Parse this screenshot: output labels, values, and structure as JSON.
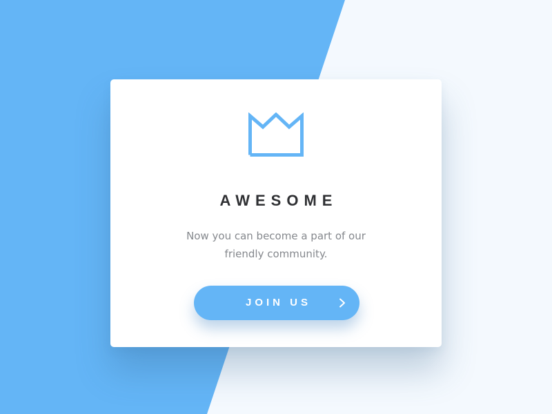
{
  "colors": {
    "page_background": "#f4f9fe",
    "accent_blue": "#64b5f6",
    "card_background": "#ffffff",
    "title_text": "#2f3033",
    "body_text": "#85888d"
  },
  "card": {
    "icon": "crown-icon",
    "title": "AWESOME",
    "description": "Now you can become a part of our friendly community.",
    "button": {
      "label": "JOIN US",
      "icon": "chevron-right-icon"
    }
  }
}
